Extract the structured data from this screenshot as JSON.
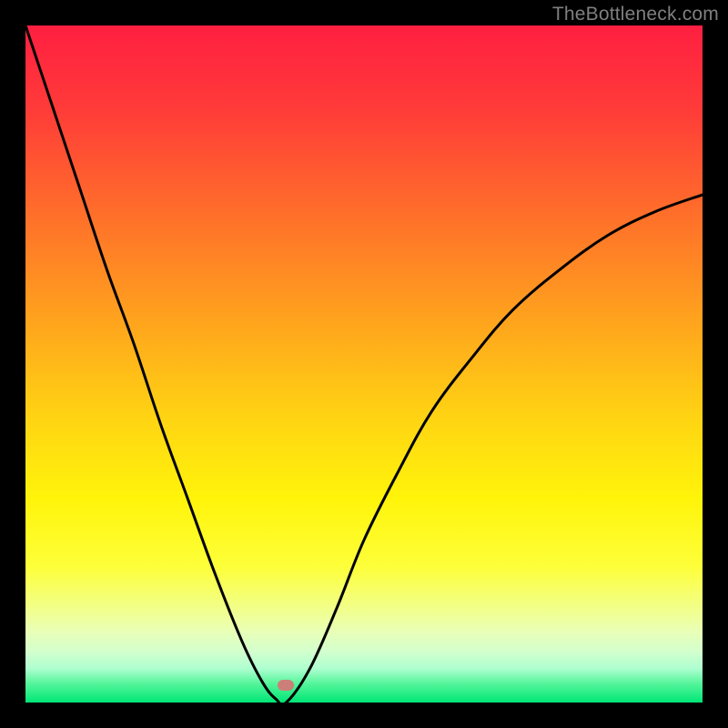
{
  "attribution": "TheBottleneck.com",
  "chart_data": {
    "type": "line",
    "title": "",
    "xlabel": "",
    "ylabel": "",
    "xlim": [
      0,
      100
    ],
    "ylim": [
      0,
      100
    ],
    "background_gradient": {
      "stops": [
        {
          "offset": 0.0,
          "color": "#ff1f41"
        },
        {
          "offset": 0.12,
          "color": "#ff3a39"
        },
        {
          "offset": 0.28,
          "color": "#ff6f2a"
        },
        {
          "offset": 0.45,
          "color": "#ffa81c"
        },
        {
          "offset": 0.58,
          "color": "#ffd413"
        },
        {
          "offset": 0.7,
          "color": "#fff40a"
        },
        {
          "offset": 0.8,
          "color": "#fdff3a"
        },
        {
          "offset": 0.86,
          "color": "#f2ff88"
        },
        {
          "offset": 0.895,
          "color": "#e9ffb6"
        },
        {
          "offset": 0.925,
          "color": "#d3ffce"
        },
        {
          "offset": 0.95,
          "color": "#aEffd0"
        },
        {
          "offset": 0.972,
          "color": "#55f59a"
        },
        {
          "offset": 1.0,
          "color": "#00e676"
        }
      ]
    },
    "series": [
      {
        "name": "bottleneck-curve",
        "x": [
          0,
          4,
          8,
          12,
          16,
          20,
          24,
          28,
          32,
          35,
          37,
          38.5,
          42,
          46,
          50,
          55,
          60,
          66,
          72,
          79,
          86,
          93,
          100
        ],
        "y": [
          100,
          88,
          76,
          64,
          53,
          41,
          30,
          19,
          9,
          3,
          0.5,
          0,
          5,
          14,
          24,
          34,
          43,
          51,
          58,
          64,
          69,
          72.5,
          75
        ]
      }
    ],
    "marker": {
      "x": 38.5,
      "y": 2.5,
      "color": "#cc7f78"
    }
  }
}
